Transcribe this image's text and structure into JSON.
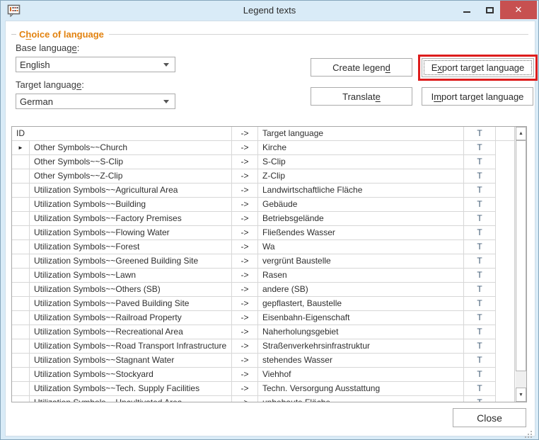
{
  "window": {
    "title": "Legend texts"
  },
  "colors": {
    "titlebar_bg": "#d9ebf7",
    "close_button_red": "#c75050",
    "accent_orange": "#e2820f",
    "highlight_red": "#dd1d1d"
  },
  "icons": {
    "close_x": "✕",
    "scroll_up": "▲",
    "scroll_down": "▼",
    "row_marker": "►"
  },
  "language_group": {
    "title": {
      "pre": "C",
      "key": "h",
      "post": "oice of language"
    },
    "base_label": {
      "pre": "Base languag",
      "key": "e",
      "post": ":"
    },
    "base_value": "English",
    "target_label": {
      "pre": "Target languag",
      "key": "e",
      "post": ":"
    },
    "target_value": "German"
  },
  "buttons": {
    "create_legend": {
      "pre": "Create legen",
      "key": "d",
      "post": ""
    },
    "export_target": {
      "pre": "E",
      "key": "x",
      "post": "port target language"
    },
    "translate": {
      "pre": "Translat",
      "key": "e",
      "post": ""
    },
    "import_target": {
      "pre": "I",
      "key": "m",
      "post": "port target language"
    },
    "close": "Close"
  },
  "table": {
    "headers": {
      "id": "ID",
      "arrow": "->",
      "target": "Target language",
      "t": "T"
    },
    "arrow": "->",
    "t": "T",
    "row_marker": "►",
    "rows": [
      {
        "id": "Other Symbols~~Church",
        "target": "Kirche"
      },
      {
        "id": "Other Symbols~~S-Clip",
        "target": "S-Clip"
      },
      {
        "id": "Other Symbols~~Z-Clip",
        "target": "Z-Clip"
      },
      {
        "id": "Utilization Symbols~~Agricultural Area",
        "target": "Landwirtschaftliche Fläche"
      },
      {
        "id": "Utilization Symbols~~Building",
        "target": "Gebäude"
      },
      {
        "id": "Utilization Symbols~~Factory Premises",
        "target": "Betriebsgelände"
      },
      {
        "id": "Utilization Symbols~~Flowing Water",
        "target": "Fließendes Wasser"
      },
      {
        "id": "Utilization Symbols~~Forest",
        "target": "Wa"
      },
      {
        "id": "Utilization Symbols~~Greened Building Site",
        "target": "vergrünt Baustelle"
      },
      {
        "id": "Utilization Symbols~~Lawn",
        "target": "Rasen"
      },
      {
        "id": "Utilization Symbols~~Others (SB)",
        "target": "andere (SB)"
      },
      {
        "id": "Utilization Symbols~~Paved Building Site",
        "target": "gepflastert, Baustelle"
      },
      {
        "id": "Utilization Symbols~~Railroad Property",
        "target": "Eisenbahn-Eigenschaft"
      },
      {
        "id": "Utilization Symbols~~Recreational Area",
        "target": "Naherholungsgebiet"
      },
      {
        "id": "Utilization Symbols~~Road Transport Infrastructure",
        "target": "Straßenverkehrsinfrastruktur"
      },
      {
        "id": "Utilization Symbols~~Stagnant Water",
        "target": "stehendes Wasser"
      },
      {
        "id": "Utilization Symbols~~Stockyard",
        "target": "Viehhof"
      },
      {
        "id": "Utilization Symbols~~Tech. Supply Facilities",
        "target": "Techn. Versorgung Ausstattung"
      },
      {
        "id": "Utilization Symbols~~Uncultivated Area",
        "target": "unbebaute Fläche"
      }
    ]
  }
}
